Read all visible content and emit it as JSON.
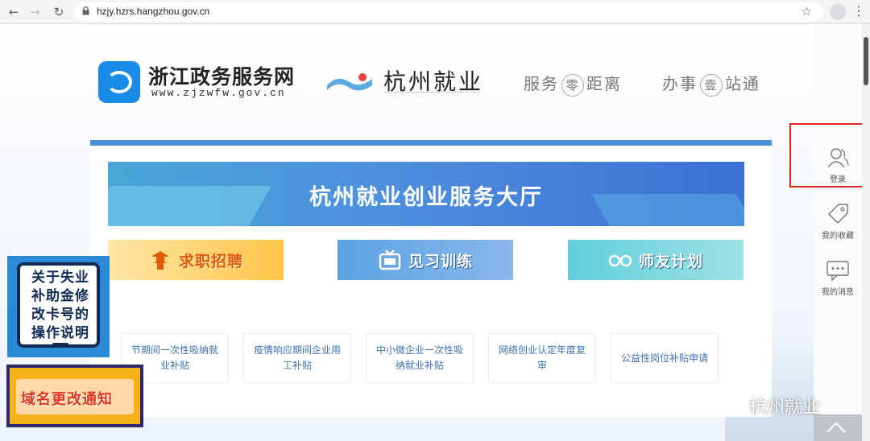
{
  "browser": {
    "url": "hzjy.hzrs.hangzhou.gov.cn"
  },
  "header": {
    "zj_title": "浙江政务服务网",
    "zj_url": "www.zjzwfw.gov.cn",
    "hz_title": "杭州就业",
    "slogan1": {
      "pre": "服务",
      "circ": "零",
      "post": "距离"
    },
    "slogan2": {
      "pre": "办事",
      "circ": "壹",
      "post": "站通"
    }
  },
  "banner": {
    "title": "杭州就业创业服务大厅"
  },
  "services": [
    {
      "label": "求职招聘"
    },
    {
      "label": "见习训练"
    },
    {
      "label": "师友计划"
    }
  ],
  "subservices": [
    "节期间一次性吸纳就业补贴",
    "疫情响应期间企业用工补贴",
    "中小微企业一次性吸纳就业补贴",
    "网络创业认定年度复审",
    "公益性岗位补贴申请"
  ],
  "notices": {
    "unemployment": "关于失业补助金修改卡号的操作说明",
    "domain_change": "域名更改通知"
  },
  "sidebar": {
    "login": "登录",
    "favorites": "我的收藏",
    "messages": "我的消息"
  },
  "watermark": "杭州就业",
  "colors": {
    "accent": "#4a90d9",
    "highlight": "#e0231b"
  }
}
